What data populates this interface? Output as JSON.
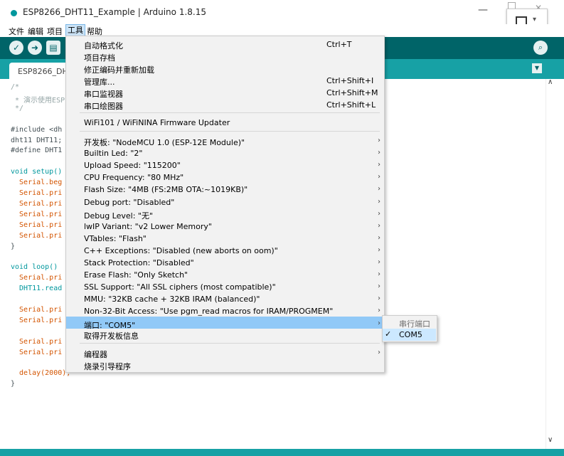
{
  "window": {
    "title": "ESP8266_DHT11_Example | Arduino 1.8.15",
    "minimize": "—",
    "close": "✕"
  },
  "menubar": {
    "items": [
      "文件",
      "编辑",
      "项目",
      "工具",
      "帮助"
    ]
  },
  "tab": {
    "label": "ESP8266_DHT"
  },
  "code": [
    {
      "t": "/*",
      "c": "c-comment"
    },
    {
      "t": " * 演示使用ESP",
      "c": "c-comment"
    },
    {
      "t": " */",
      "c": "c-comment"
    },
    {
      "t": "",
      "c": "c-plain"
    },
    {
      "t": "#include <dh",
      "c": "c-plain"
    },
    {
      "t": "dht11 DHT11;",
      "c": "c-plain"
    },
    {
      "t": "#define DHT1",
      "c": "c-plain"
    },
    {
      "t": "",
      "c": "c-plain"
    },
    {
      "t": "void setup()",
      "c": "c-type"
    },
    {
      "t": "  Serial.beg",
      "c": "c-fn"
    },
    {
      "t": "  Serial.pri",
      "c": "c-fn"
    },
    {
      "t": "  Serial.pri",
      "c": "c-fn"
    },
    {
      "t": "  Serial.pri",
      "c": "c-fn"
    },
    {
      "t": "  Serial.pri",
      "c": "c-fn"
    },
    {
      "t": "  Serial.pri",
      "c": "c-fn"
    },
    {
      "t": "}",
      "c": "c-plain"
    },
    {
      "t": "",
      "c": "c-plain"
    },
    {
      "t": "void loop()",
      "c": "c-type"
    },
    {
      "t": "  Serial.pri",
      "c": "c-fn"
    },
    {
      "t": "  DHT11.read",
      "c": "c-type"
    },
    {
      "t": "",
      "c": "c-plain"
    },
    {
      "t": "  Serial.pri",
      "c": "c-fn"
    },
    {
      "t": "  Serial.pri",
      "c": "c-fn"
    },
    {
      "t": "",
      "c": "c-plain"
    },
    {
      "t": "  Serial.pri",
      "c": "c-fn"
    },
    {
      "t": "  Serial.pri",
      "c": "c-fn"
    },
    {
      "t": "",
      "c": "c-plain"
    },
    {
      "t": "  delay(2000);",
      "c": "c-fn"
    },
    {
      "t": "}",
      "c": "c-plain"
    }
  ],
  "tools_menu": {
    "group1": [
      {
        "label": "自动格式化",
        "shortcut": "Ctrl+T"
      },
      {
        "label": "项目存档",
        "shortcut": ""
      },
      {
        "label": "修正编码并重新加载",
        "shortcut": ""
      },
      {
        "label": "管理库...",
        "shortcut": "Ctrl+Shift+I"
      },
      {
        "label": "串口监视器",
        "shortcut": "Ctrl+Shift+M"
      },
      {
        "label": "串口绘图器",
        "shortcut": "Ctrl+Shift+L"
      }
    ],
    "wifi_updater": "WiFi101 / WiFiNINA Firmware Updater",
    "board_options": [
      "开发板: \"NodeMCU 1.0 (ESP-12E Module)\"",
      "Builtin Led: \"2\"",
      "Upload Speed: \"115200\"",
      "CPU Frequency: \"80 MHz\"",
      "Flash Size: \"4MB (FS:2MB OTA:~1019KB)\"",
      "Debug port: \"Disabled\"",
      "Debug Level: \"无\"",
      "lwIP Variant: \"v2 Lower Memory\"",
      "VTables: \"Flash\"",
      "C++ Exceptions: \"Disabled (new aborts on oom)\"",
      "Stack Protection: \"Disabled\"",
      "Erase Flash: \"Only Sketch\"",
      "SSL Support: \"All SSL ciphers (most compatible)\"",
      "MMU: \"32KB cache + 32KB IRAM (balanced)\"",
      "Non-32-Bit Access: \"Use pgm_read macros for IRAM/PROGMEM\"",
      "端口: \"COM5\""
    ],
    "get_board_info": "取得开发板信息",
    "programmer": "编程器",
    "burn_bootloader": "烧录引导程序"
  },
  "port_submenu": {
    "header": "串行端口",
    "selected": "COM5"
  },
  "colors": {
    "toolbar": "#006468",
    "tabbar": "#17a1a5",
    "highlight": "#91c9f7"
  }
}
